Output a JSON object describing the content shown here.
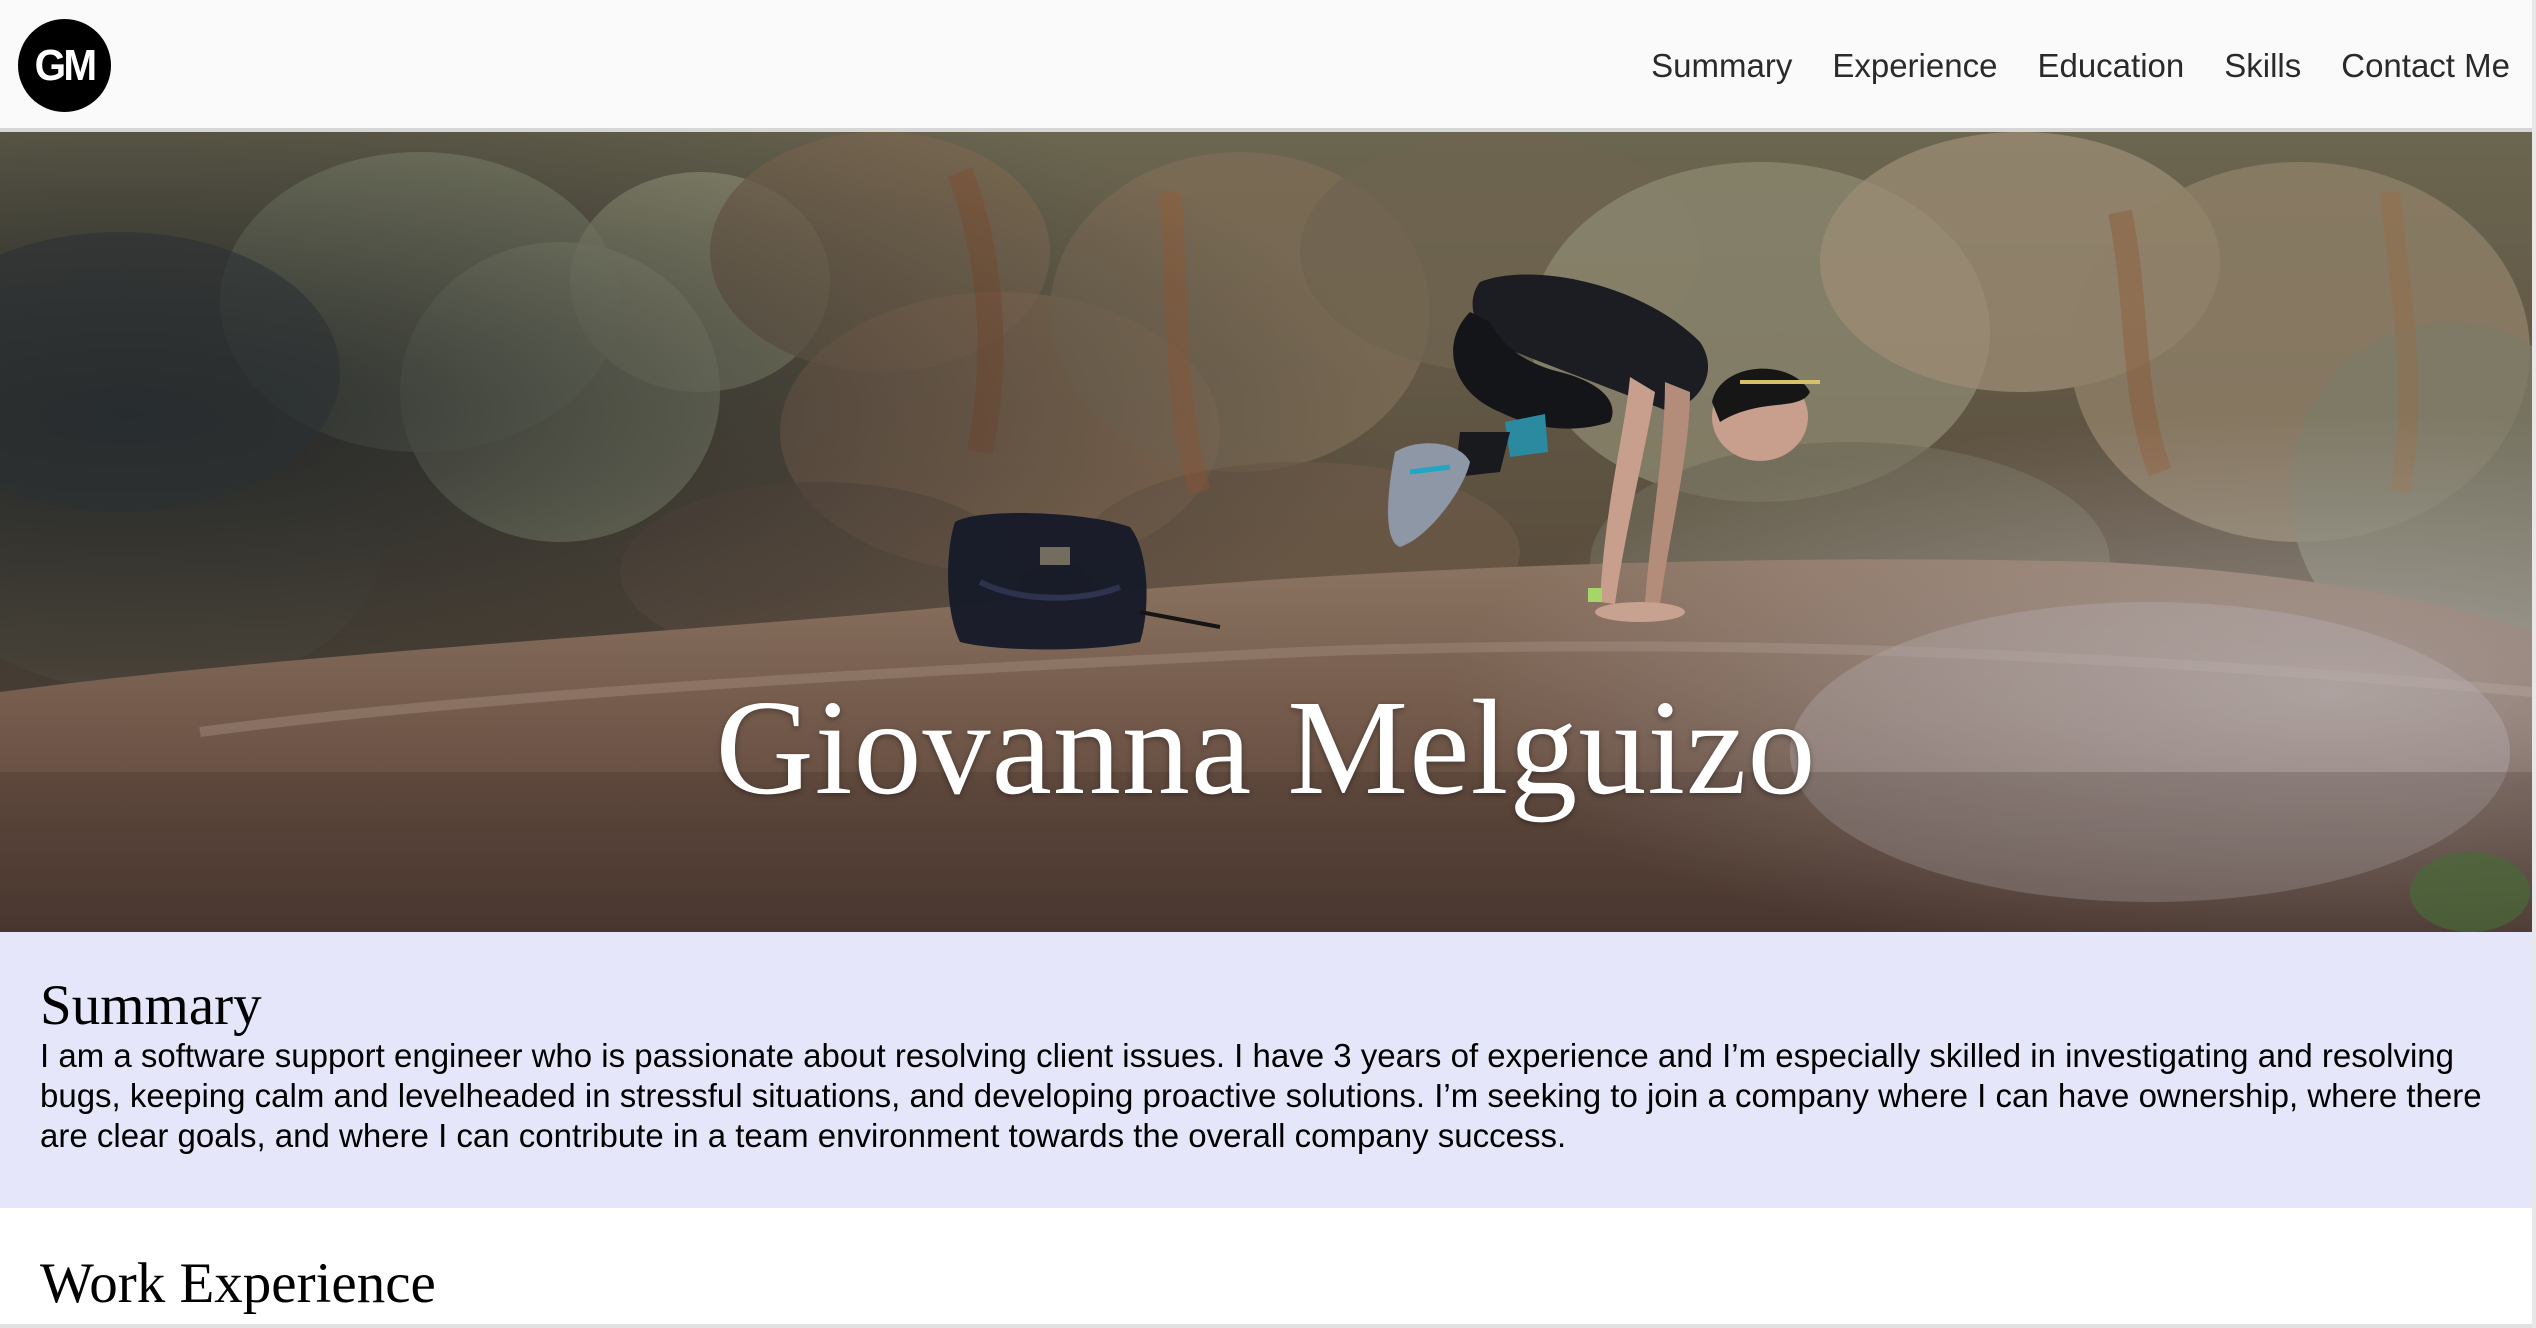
{
  "header": {
    "logo_text": "GM",
    "nav": [
      {
        "label": "Summary"
      },
      {
        "label": "Experience"
      },
      {
        "label": "Education"
      },
      {
        "label": "Skills"
      },
      {
        "label": "Contact Me"
      }
    ]
  },
  "hero": {
    "title": "Giovanna Melguizo"
  },
  "summary": {
    "heading": "Summary",
    "body": "I am a software support engineer who is passionate about resolving client issues. I have 3 years of experience and I’m especially skilled in investigating and resolving bugs, keeping calm and levelheaded in stressful situations, and developing proactive solutions. I’m seeking to join a company where I can have ownership, where there are clear goals, and where I can contribute in a team environment towards the overall company success."
  },
  "work": {
    "heading": "Work Experience"
  },
  "colors": {
    "summary_background": "#e6e6fa",
    "header_background": "#fafafa",
    "logo_background": "#000000"
  }
}
